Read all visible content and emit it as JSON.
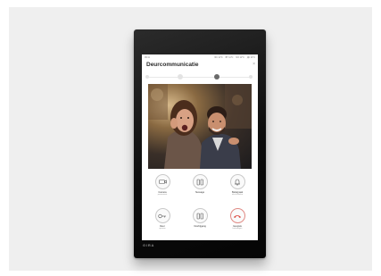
{
  "screen": {
    "status_left": "09:11",
    "status_items": [
      "ЯС 11°C",
      "ВТ 11°C",
      "NO 11°C",
      "ДС 11°C"
    ],
    "title": "Deurcommunicatie",
    "close_glyph": "×"
  },
  "controls": [
    {
      "label": "Camera",
      "sublabel": "permanent",
      "icon": "camera-icon"
    },
    {
      "label": "Sussage",
      "sublabel": "",
      "icon": "speaker-icon"
    },
    {
      "label": "Belsignaal",
      "sublabel": "uitschakelen",
      "icon": "bell-icon"
    },
    {
      "label": "Deur",
      "sublabel": "openen",
      "icon": "key-icon"
    },
    {
      "label": "Voorbijgang",
      "sublabel": "",
      "icon": "speaker-icon"
    },
    {
      "label": "Gesprek",
      "sublabel": "beëindigen",
      "icon": "hang-up-icon"
    }
  ],
  "device": {
    "brand": "GIRA"
  },
  "colors": {
    "bezel": "#0d0d0d",
    "backdrop": "#efefef",
    "end_call": "#d9443b"
  }
}
